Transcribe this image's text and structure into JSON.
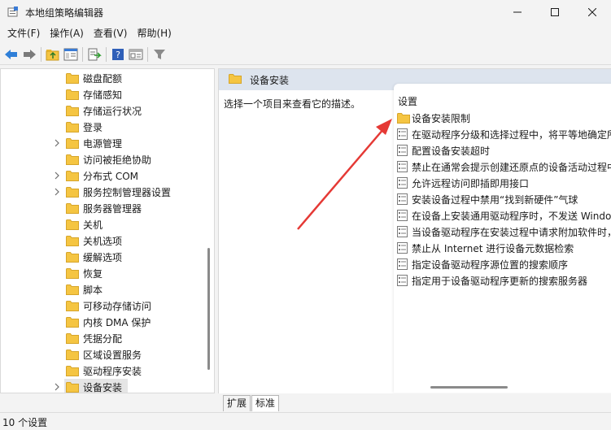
{
  "window": {
    "title": "本地组策略编辑器",
    "minimize_icon": "minimize-icon",
    "maximize_icon": "maximize-icon",
    "close_icon": "close-icon"
  },
  "menu": [
    {
      "label": "文件(F)"
    },
    {
      "label": "操作(A)"
    },
    {
      "label": "查看(V)"
    },
    {
      "label": "帮助(H)"
    }
  ],
  "toolbar": {
    "icons": [
      "back-arrow-icon",
      "forward-arrow-icon",
      "up-folder-icon",
      "show-hide-tree-icon",
      "export-list-icon",
      "help-icon",
      "properties-icon",
      "filter-icon"
    ]
  },
  "tree": {
    "items": [
      {
        "label": "磁盘配额",
        "expandable": false
      },
      {
        "label": "存储感知",
        "expandable": false
      },
      {
        "label": "存储运行状况",
        "expandable": false
      },
      {
        "label": "登录",
        "expandable": false
      },
      {
        "label": "电源管理",
        "expandable": true
      },
      {
        "label": "访问被拒绝协助",
        "expandable": false
      },
      {
        "label": "分布式 COM",
        "expandable": true
      },
      {
        "label": "服务控制管理器设置",
        "expandable": true
      },
      {
        "label": "服务器管理器",
        "expandable": false
      },
      {
        "label": "关机",
        "expandable": false
      },
      {
        "label": "关机选项",
        "expandable": false
      },
      {
        "label": "缓解选项",
        "expandable": false
      },
      {
        "label": "恢复",
        "expandable": false
      },
      {
        "label": "脚本",
        "expandable": false
      },
      {
        "label": "可移动存储访问",
        "expandable": false
      },
      {
        "label": "内核 DMA 保护",
        "expandable": false
      },
      {
        "label": "凭据分配",
        "expandable": false
      },
      {
        "label": "区域设置服务",
        "expandable": false
      },
      {
        "label": "驱动程序安装",
        "expandable": false
      },
      {
        "label": "设备安装",
        "expandable": true,
        "selected": true
      }
    ]
  },
  "details": {
    "header_title": "设备安装",
    "description": "选择一个项目来查看它的描述。",
    "column_header": "设置",
    "rows": [
      {
        "type": "folder",
        "label": "设备安装限制"
      },
      {
        "type": "setting",
        "label": "在驱动程序分级和选择过程中，将平等地确定所"
      },
      {
        "type": "setting",
        "label": "配置设备安装超时"
      },
      {
        "type": "setting",
        "label": "禁止在通常会提示创建还原点的设备活动过程中"
      },
      {
        "type": "setting",
        "label": "允许远程访问即插即用接口"
      },
      {
        "type": "setting",
        "label": "安装设备过程中禁用“找到新硬件”气球"
      },
      {
        "type": "setting",
        "label": "在设备上安装通用驱动程序时，不发送 Windo"
      },
      {
        "type": "setting",
        "label": "当设备驱动程序在安装过程中请求附加软件时，"
      },
      {
        "type": "setting",
        "label": "禁止从 Internet 进行设备元数据检索"
      },
      {
        "type": "setting",
        "label": "指定设备驱动程序源位置的搜索顺序"
      },
      {
        "type": "setting",
        "label": "指定用于设备驱动程序更新的搜索服务器"
      }
    ]
  },
  "tabs": [
    {
      "label": "扩展",
      "active": false
    },
    {
      "label": "标准",
      "active": true
    }
  ],
  "status": {
    "text": "10 个设置"
  },
  "colors": {
    "header_bg": "#dde4ee",
    "folder_yellow": "#f5c542",
    "annotation_arrow": "#e53935"
  }
}
